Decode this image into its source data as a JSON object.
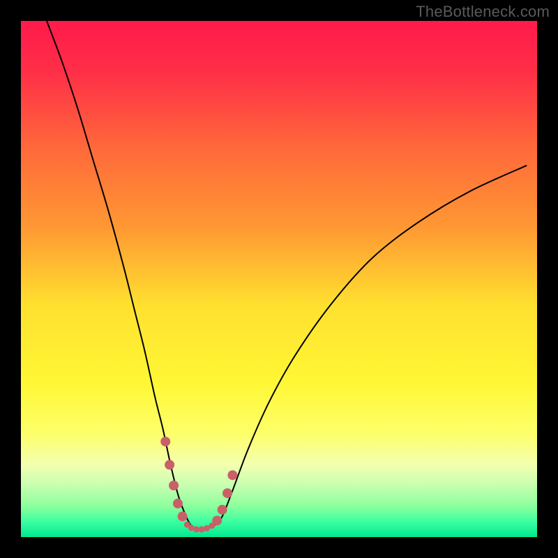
{
  "watermark": "TheBottleneck.com",
  "chart_data": {
    "type": "line",
    "title": "",
    "xlabel": "",
    "ylabel": "",
    "xlim": [
      0,
      100
    ],
    "ylim": [
      0,
      100
    ],
    "grid": false,
    "background_gradient": {
      "stops": [
        {
          "offset": 0.0,
          "color": "#ff1a4b"
        },
        {
          "offset": 0.1,
          "color": "#ff2f47"
        },
        {
          "offset": 0.25,
          "color": "#ff6a3a"
        },
        {
          "offset": 0.4,
          "color": "#ff9833"
        },
        {
          "offset": 0.55,
          "color": "#ffe02f"
        },
        {
          "offset": 0.7,
          "color": "#fff734"
        },
        {
          "offset": 0.8,
          "color": "#fdff6a"
        },
        {
          "offset": 0.86,
          "color": "#f3ffb0"
        },
        {
          "offset": 0.9,
          "color": "#c7ffb0"
        },
        {
          "offset": 0.94,
          "color": "#8cff9c"
        },
        {
          "offset": 0.97,
          "color": "#3bffa1"
        },
        {
          "offset": 1.0,
          "color": "#00e98e"
        }
      ]
    },
    "series": [
      {
        "name": "bottleneck-curve",
        "stroke": "#000000",
        "stroke_width": 2,
        "x": [
          5,
          8,
          11,
          14,
          17,
          20,
          22,
          24,
          26,
          27.5,
          29,
          30.5,
          32,
          33,
          34,
          35,
          36,
          37.5,
          39,
          41,
          44,
          48,
          53,
          60,
          68,
          77,
          87,
          98
        ],
        "y": [
          100,
          92,
          83,
          73,
          63,
          52,
          44,
          36,
          27,
          21,
          14,
          8,
          4,
          2.2,
          1.6,
          1.5,
          1.7,
          2.3,
          4,
          9,
          17,
          26,
          35,
          45,
          54,
          61,
          67,
          72
        ]
      }
    ],
    "markers": {
      "name": "highlight-dots",
      "fill": "#c96068",
      "radius_small": 4.5,
      "radius_large": 7,
      "points": [
        {
          "x": 28.0,
          "y": 18.5,
          "r": "large"
        },
        {
          "x": 28.8,
          "y": 14.0,
          "r": "large"
        },
        {
          "x": 29.6,
          "y": 10.0,
          "r": "large"
        },
        {
          "x": 30.4,
          "y": 6.5,
          "r": "large"
        },
        {
          "x": 31.3,
          "y": 4.0,
          "r": "large"
        },
        {
          "x": 32.2,
          "y": 2.4,
          "r": "small"
        },
        {
          "x": 33.0,
          "y": 1.8,
          "r": "small"
        },
        {
          "x": 34.0,
          "y": 1.5,
          "r": "small"
        },
        {
          "x": 35.0,
          "y": 1.5,
          "r": "small"
        },
        {
          "x": 36.0,
          "y": 1.7,
          "r": "small"
        },
        {
          "x": 37.0,
          "y": 2.2,
          "r": "small"
        },
        {
          "x": 38.0,
          "y": 3.2,
          "r": "large"
        },
        {
          "x": 39.0,
          "y": 5.3,
          "r": "large"
        },
        {
          "x": 40.0,
          "y": 8.5,
          "r": "large"
        },
        {
          "x": 41.0,
          "y": 12.0,
          "r": "large"
        }
      ]
    }
  }
}
